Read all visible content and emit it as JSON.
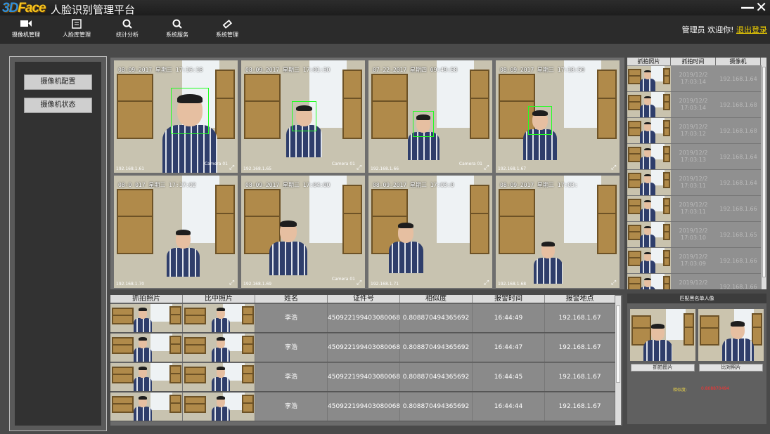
{
  "app": {
    "logo_a": "3D",
    "logo_b": "Face",
    "title": "人脸识别管理平台",
    "minimize": "—",
    "close": "✕"
  },
  "toolbar": [
    {
      "label": "摄像机管理",
      "icon": "camera-icon"
    },
    {
      "label": "人脸库管理",
      "icon": "face-library-icon"
    },
    {
      "label": "统计分析",
      "icon": "search-icon"
    },
    {
      "label": "系统服务",
      "icon": "search-icon"
    },
    {
      "label": "系统管理",
      "icon": "tool-icon"
    }
  ],
  "user": {
    "role": "管理员",
    "welcome": "欢迎你!",
    "logout": "退出登录"
  },
  "left": {
    "config": "摄像机配置",
    "status": "摄像机状态"
  },
  "cameras": [
    {
      "ts": "08-09-2017 星期三 17:16:18",
      "ip": "192.168.1.61",
      "label": "Camera 01"
    },
    {
      "ts": "08-09-2017 星期三 17:01:30",
      "ip": "192.168.1.65",
      "label": "Camera 01"
    },
    {
      "ts": "07-22-2017 星期四 09:49:58",
      "ip": "192.168.1.66",
      "label": "Camera 01"
    },
    {
      "ts": "08-09-2017 星期三 17:18:50",
      "ip": "192.168.1.67",
      "label": ""
    },
    {
      "ts": "08-0 017 星期三 17:17:02",
      "ip": "192.168.1.70",
      "label": ""
    },
    {
      "ts": "08-09-2017 星期三 17:04:00",
      "ip": "192.168.1.69",
      "label": "Camera 01"
    },
    {
      "ts": "08-09-2017 星期三 17:03:0",
      "ip": "192.168.1.71",
      "label": ""
    },
    {
      "ts": "08-09-2017 星期三 17:03:",
      "ip": "192.168.1.68",
      "label": ""
    }
  ],
  "alarm_table": {
    "headers": [
      "抓拍照片",
      "比中照片",
      "姓名",
      "证件号",
      "相似度",
      "报警时间",
      "报警地点"
    ],
    "rows": [
      {
        "name": "李浩",
        "id": "450922199403080068",
        "sim": "0.808870494365692",
        "time": "16:44:49",
        "loc": "192.168.1.67"
      },
      {
        "name": "李浩",
        "id": "450922199403080068",
        "sim": "0.808870494365692",
        "time": "16:44:47",
        "loc": "192.168.1.67"
      },
      {
        "name": "李浩",
        "id": "450922199403080068",
        "sim": "0.808870494365692",
        "time": "16:44:45",
        "loc": "192.168.1.67"
      },
      {
        "name": "李浩",
        "id": "450922199403080068",
        "sim": "0.808870494365692",
        "time": "16:44:44",
        "loc": "192.168.1.67"
      }
    ]
  },
  "capture_list": {
    "headers": [
      "抓拍照片",
      "抓拍时间",
      "摄像机"
    ],
    "rows": [
      {
        "time": "2019/12/2 17:03:14",
        "cam": "192.168.1.64"
      },
      {
        "time": "2019/12/2 17:03:14",
        "cam": "192.168.1.68"
      },
      {
        "time": "2019/12/2 17:03:12",
        "cam": "192.168.1.68"
      },
      {
        "time": "2019/12/2 17:03:13",
        "cam": "192.168.1.64"
      },
      {
        "time": "2019/12/2 17:03:11",
        "cam": "192.168.1.64"
      },
      {
        "time": "2019/12/2 17:03:11",
        "cam": "192.168.1.66"
      },
      {
        "time": "2019/12/2 17:03:10",
        "cam": "192.168.1.65"
      },
      {
        "time": "2019/12/2 17:03:09",
        "cam": "192.168.1.66"
      },
      {
        "time": "2019/12/2",
        "cam": "192.168.1.66"
      }
    ]
  },
  "match": {
    "title": "匹配黑名单人像",
    "capture_btn": "抓拍图片",
    "compare_btn": "比对照片",
    "sim_label": "相似度:",
    "sim_value": "0.808870494"
  },
  "colors": {
    "facebox": "#22ff22",
    "logout": "#f5d400",
    "sim_value": "#ff3030",
    "sim_label": "#e8d24a"
  }
}
